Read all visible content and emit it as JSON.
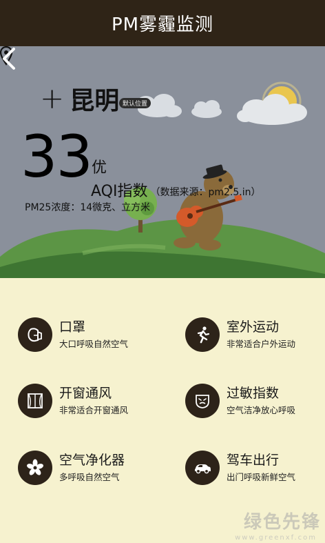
{
  "app": {
    "title": "PM雾霾监测"
  },
  "location": {
    "city": "昆明",
    "default_badge": "默认位置",
    "add_symbol": "+"
  },
  "aqi": {
    "value": "33",
    "level": "优",
    "label": "AQI指数",
    "source": "（数据来源：pm2.5.in）",
    "pm25_line": "PM25浓度：14微克、立方米"
  },
  "items": [
    {
      "icon": "mask-icon",
      "title": "口罩",
      "subtitle": "大口呼吸自然空气"
    },
    {
      "icon": "runner-icon",
      "title": "室外运动",
      "subtitle": "非常适合户外运动"
    },
    {
      "icon": "window-icon",
      "title": "开窗通风",
      "subtitle": "非常适合开窗通风"
    },
    {
      "icon": "allergy-face-icon",
      "title": "过敏指数",
      "subtitle": "空气洁净放心呼吸"
    },
    {
      "icon": "flower-icon",
      "title": "空气净化器",
      "subtitle": "多呼吸自然空气"
    },
    {
      "icon": "car-icon",
      "title": "驾车出行",
      "subtitle": "出门呼吸新鲜空气"
    }
  ],
  "watermark": {
    "text": "绿色先锋",
    "url": "www.greenxf.com"
  },
  "colors": {
    "header": "#2f2417",
    "hero_bg": "#8a909b",
    "content_bg": "#f6f2cf",
    "icon_bg": "#2d2319",
    "hill": "#4f8a3d"
  }
}
